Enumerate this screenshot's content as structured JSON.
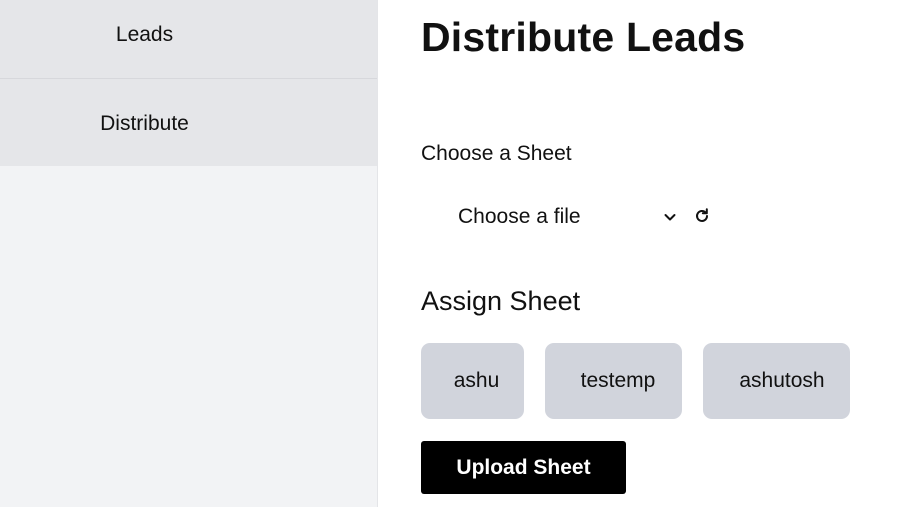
{
  "sidebar": {
    "items": [
      {
        "label": "Leads"
      },
      {
        "label": "Distribute"
      }
    ]
  },
  "main": {
    "title": "Distribute Leads",
    "choose_sheet_label": "Choose a Sheet",
    "file_select": {
      "value": "Choose a file",
      "dropdown_icon": "chevron-down-icon",
      "refresh_icon": "refresh-icon"
    },
    "assign_title": "Assign Sheet",
    "assignees": [
      {
        "name": "ashu"
      },
      {
        "name": "testemp"
      },
      {
        "name": "ashutosh"
      }
    ],
    "upload_label": "Upload Sheet"
  },
  "colors": {
    "sidebar_bg": "#f2f3f5",
    "nav_item_bg": "#e5e6e9",
    "chip_bg": "#d1d4dc",
    "button_bg": "#000000",
    "button_text": "#ffffff"
  }
}
